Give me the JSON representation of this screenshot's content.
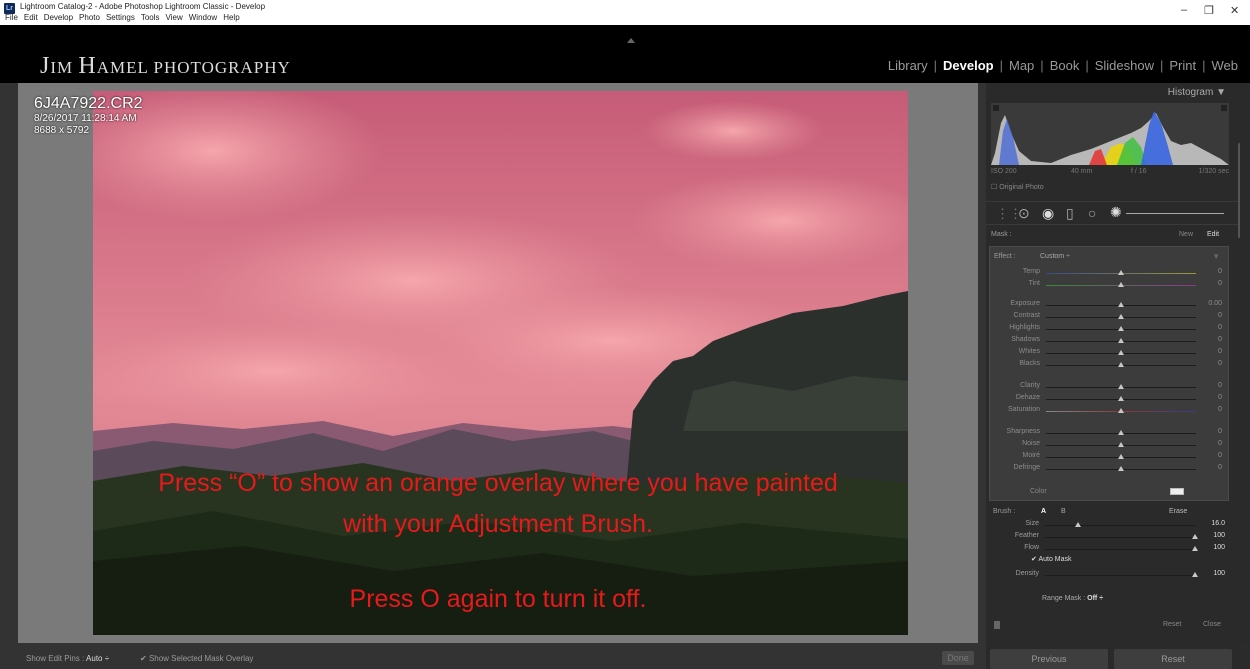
{
  "window": {
    "title": "Lightroom Catalog-2 - Adobe Photoshop Lightroom Classic - Develop",
    "menu": [
      "File",
      "Edit",
      "Develop",
      "Photo",
      "Settings",
      "Tools",
      "View",
      "Window",
      "Help"
    ],
    "controls": {
      "minimize": "–",
      "restore": "❐",
      "close": "✕"
    }
  },
  "brand": {
    "first": "J",
    "im": "IM ",
    "h": "H",
    "amel": "AMEL ",
    "photography": "PHOTOGRAPHY"
  },
  "modules": [
    "Library",
    "Develop",
    "Map",
    "Book",
    "Slideshow",
    "Print",
    "Web"
  ],
  "active_module": "Develop",
  "photo_info": {
    "filename": "6J4A7922.CR2",
    "datetime": "8/26/2017 11:28:14 AM",
    "dimensions": "8688 x 5792"
  },
  "overlay_text": {
    "line1": "Press “O” to show an orange overlay where you have painted",
    "line2": "with your Adjustment Brush.",
    "line3": "Press O again to turn it off."
  },
  "toolbar": {
    "show_edit_pins_label": "Show Edit Pins :",
    "show_edit_pins_value": "Auto ÷",
    "mask_overlay": "Show Selected Mask Overlay",
    "done": "Done"
  },
  "histogram": {
    "title": "Histogram ▼",
    "iso": "ISO 200",
    "focal": "40 mm",
    "aperture": "f / 16",
    "shutter": "1/320 sec",
    "original_photo": "Original Photo"
  },
  "mask": {
    "label": "Mask :",
    "new": "New",
    "edit": "Edit"
  },
  "effect": {
    "label": "Effect :",
    "value": "Custom ÷"
  },
  "sliders": [
    {
      "label": "Temp",
      "value": "0",
      "pos": 0.5
    },
    {
      "label": "Tint",
      "value": "0",
      "pos": 0.5
    },
    {
      "label": "Exposure",
      "value": "0.00",
      "pos": 0.5
    },
    {
      "label": "Contrast",
      "value": "0",
      "pos": 0.5
    },
    {
      "label": "Highlights",
      "value": "0",
      "pos": 0.5
    },
    {
      "label": "Shadows",
      "value": "0",
      "pos": 0.5
    },
    {
      "label": "Whites",
      "value": "0",
      "pos": 0.5
    },
    {
      "label": "Blacks",
      "value": "0",
      "pos": 0.5
    },
    {
      "label": "Clarity",
      "value": "0",
      "pos": 0.5
    },
    {
      "label": "Dehaze",
      "value": "0",
      "pos": 0.5
    },
    {
      "label": "Saturation",
      "value": "0",
      "pos": 0.5
    },
    {
      "label": "Sharpness",
      "value": "0",
      "pos": 0.5
    },
    {
      "label": "Noise",
      "value": "0",
      "pos": 0.5
    },
    {
      "label": "Moiré",
      "value": "0",
      "pos": 0.5
    },
    {
      "label": "Defringe",
      "value": "0",
      "pos": 0.5
    }
  ],
  "color_label": "Color",
  "brush": {
    "label": "Brush :",
    "a": "A",
    "b": "B",
    "erase": "Erase",
    "size": {
      "label": "Size",
      "value": "16.0",
      "pos": 0.22
    },
    "feather": {
      "label": "Feather",
      "value": "100",
      "pos": 1.0
    },
    "flow": {
      "label": "Flow",
      "value": "100",
      "pos": 1.0
    },
    "automask": "Auto Mask",
    "density": {
      "label": "Density",
      "value": "100",
      "pos": 1.0
    }
  },
  "range_mask": {
    "label": "Range Mask :",
    "value": "Off ÷"
  },
  "panel_buttons": {
    "reset": "Reset",
    "close": "Close",
    "previous": "Previous",
    "reset_big": "Reset"
  },
  "colors": {
    "overlay_text": "#e8191b",
    "sky_overlay": "#d0607a",
    "panel_bg": "#2a2a2a"
  }
}
